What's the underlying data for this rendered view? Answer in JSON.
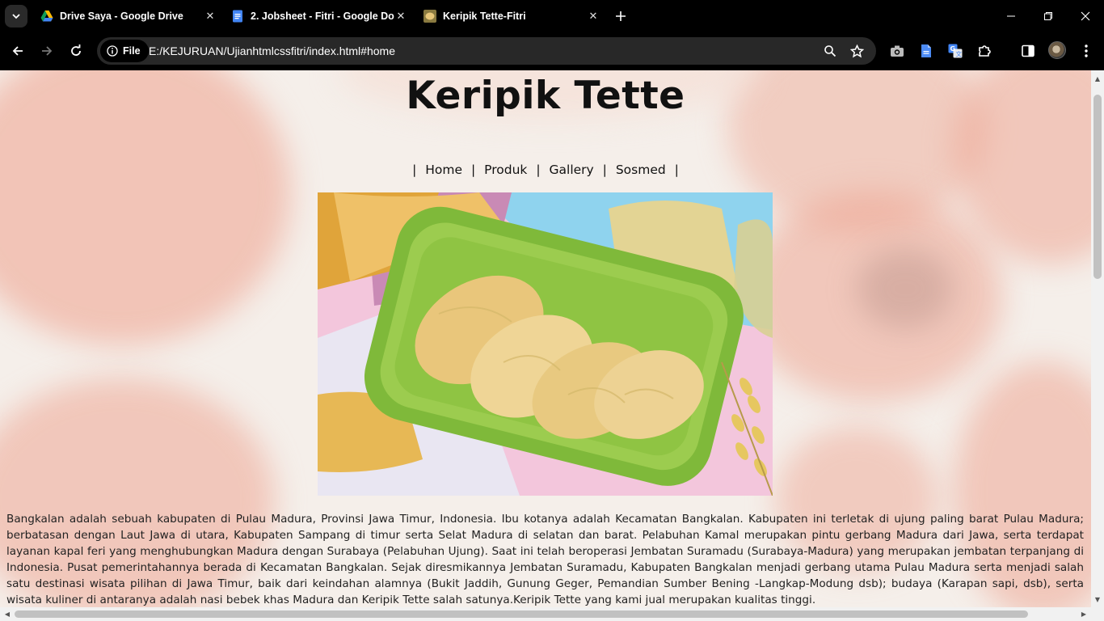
{
  "browser": {
    "tabs": [
      {
        "title": "Drive Saya - Google Drive",
        "icon": "google-drive-icon"
      },
      {
        "title": "2. Jobsheet - Fitri - Google Dok",
        "icon": "google-docs-icon"
      },
      {
        "title": "Keripik Tette-Fitri",
        "icon": "keripik-favicon",
        "active": true
      }
    ],
    "site_chip": "File",
    "url": "E:/KEJURUAN/Ujianhtmlcssfitri/index.html#home"
  },
  "page": {
    "title": "Keripik Tette",
    "nav": [
      "Home",
      "Produk",
      "Gallery",
      "Sosmed"
    ],
    "nav_separator": "|",
    "hero_alt": "keripik tette",
    "description": "Bangkalan adalah sebuah kabupaten di Pulau Madura, Provinsi Jawa Timur, Indonesia. Ibu kotanya adalah Kecamatan Bangkalan. Kabupaten ini terletak di ujung paling barat Pulau Madura; berbatasan dengan Laut Jawa di utara, Kabupaten Sampang di timur serta Selat Madura di selatan dan barat. Pelabuhan Kamal merupakan pintu gerbang Madura dari Jawa, serta terdapat layanan kapal feri yang menghubungkan Madura dengan Surabaya (Pelabuhan Ujung). Saat ini telah beroperasi Jembatan Suramadu (Surabaya-Madura) yang merupakan jembatan terpanjang di Indonesia. Pusat pemerintahannya berada di Kecamatan Bangkalan. Sejak diresmikannya Jembatan Suramadu, Kabupaten Bangkalan menjadi gerbang utama Pulau Madura serta menjadi salah satu destinasi wisata pilihan di Jawa Timur, baik dari keindahan alamnya (Bukit Jaddih, Gunung Geger, Pemandian Sumber Bening -Langkap-Modung dsb); budaya (Karapan sapi, dsb), serta wisata kuliner di antaranya adalah nasi bebek khas Madura dan Keripik Tette salah satunya.Keripik Tette yang kami jual merupakan kualitas tinggi."
  },
  "colors": {
    "background": "#f5efea",
    "watercolor": "#eea08c",
    "tray": "#8cc63f",
    "chip": "#e8c77a"
  }
}
